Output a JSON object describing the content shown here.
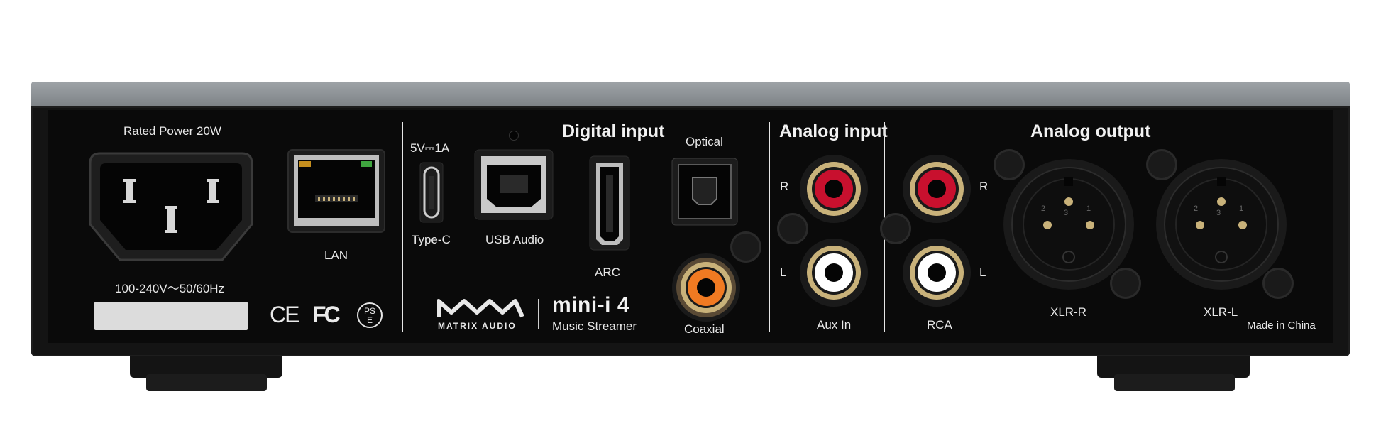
{
  "panel": {
    "power": {
      "rated": "Rated Power 20W",
      "voltage": "100-240V～50/60Hz"
    },
    "lan": {
      "label": "LAN"
    },
    "usb_c": {
      "rating": "5V⎓1A",
      "label": "Type-C"
    },
    "usb_audio": {
      "label": "USB Audio"
    },
    "digital": {
      "heading": "Digital input",
      "arc_label": "ARC",
      "optical_label": "Optical",
      "coaxial_label": "Coaxial"
    },
    "brand": {
      "wordmark": "MATRIX AUDIO",
      "model": "mini-i 4",
      "subtitle": "Music Streamer"
    },
    "analog_in": {
      "heading": "Analog input",
      "r": "R",
      "l": "L",
      "label": "Aux In"
    },
    "rca_out": {
      "r": "R",
      "l": "L",
      "label": "RCA"
    },
    "analog_out": {
      "heading": "Analog output",
      "xlr_r": "XLR-R",
      "xlr_l": "XLR-L",
      "made_in": "Made in China",
      "pin1": "1",
      "pin2": "2",
      "pin3": "3"
    },
    "certs": {
      "ce": "CE",
      "fc": "FC",
      "pse_top": "PS",
      "pse_bottom": "E"
    }
  },
  "colors": {
    "chassis": "#141414",
    "top_strip": "#8e9396",
    "rca_red": "#c8102e",
    "rca_white": "#ffffff",
    "rca_orange": "#f07a22",
    "gold": "#c9b27a"
  },
  "icons": [
    "iec-power-inlet-icon",
    "ethernet-port-icon",
    "usb-c-port-icon",
    "usb-b-port-icon",
    "hdmi-port-icon",
    "optical-port-icon",
    "rca-jack-icon",
    "xlr-connector-icon",
    "ce-mark-icon",
    "fc-mark-icon",
    "pse-mark-icon",
    "matrix-audio-logo-icon"
  ]
}
